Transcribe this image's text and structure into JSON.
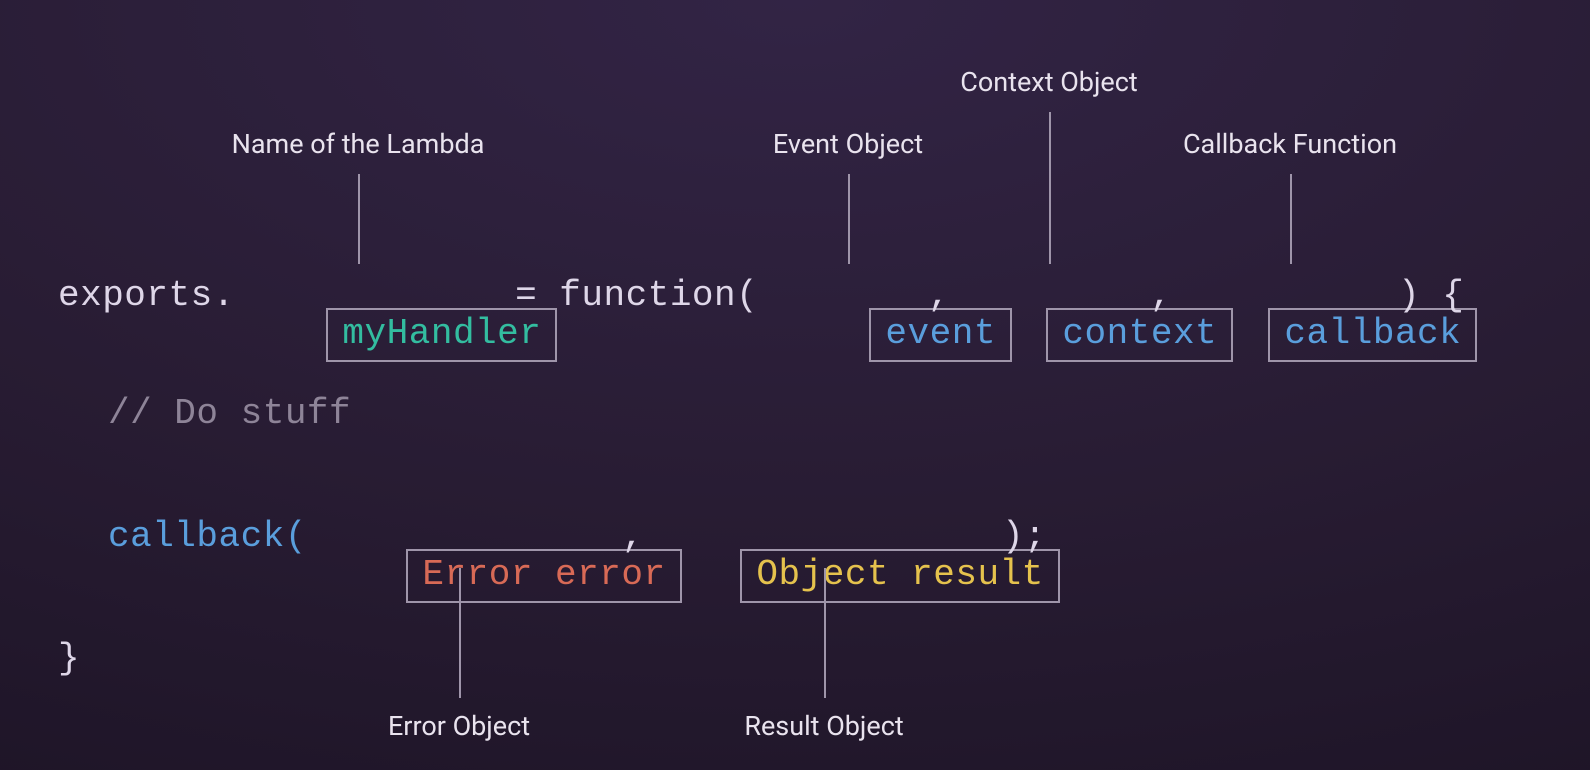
{
  "labels": {
    "lambdaName": "Name of the Lambda",
    "eventObject": "Event Object",
    "contextObject": "Context Object",
    "callbackFunction": "Callback Function",
    "errorObject": "Error Object",
    "resultObject": "Result Object"
  },
  "code": {
    "exportsDot": "exports.",
    "myHandler": "myHandler",
    "eqFunctionOpen": " = function(",
    "event": "event",
    "commaSep": ",",
    "context": "context",
    "callbackParam": "callback",
    "closeParenOpenBrace": ") {",
    "comment": "// Do stuff",
    "callbackCall": "callback(",
    "errorError": "Error error",
    "objectResult": "Object result",
    "closeCallSemi": ");",
    "closeBrace": "}"
  }
}
